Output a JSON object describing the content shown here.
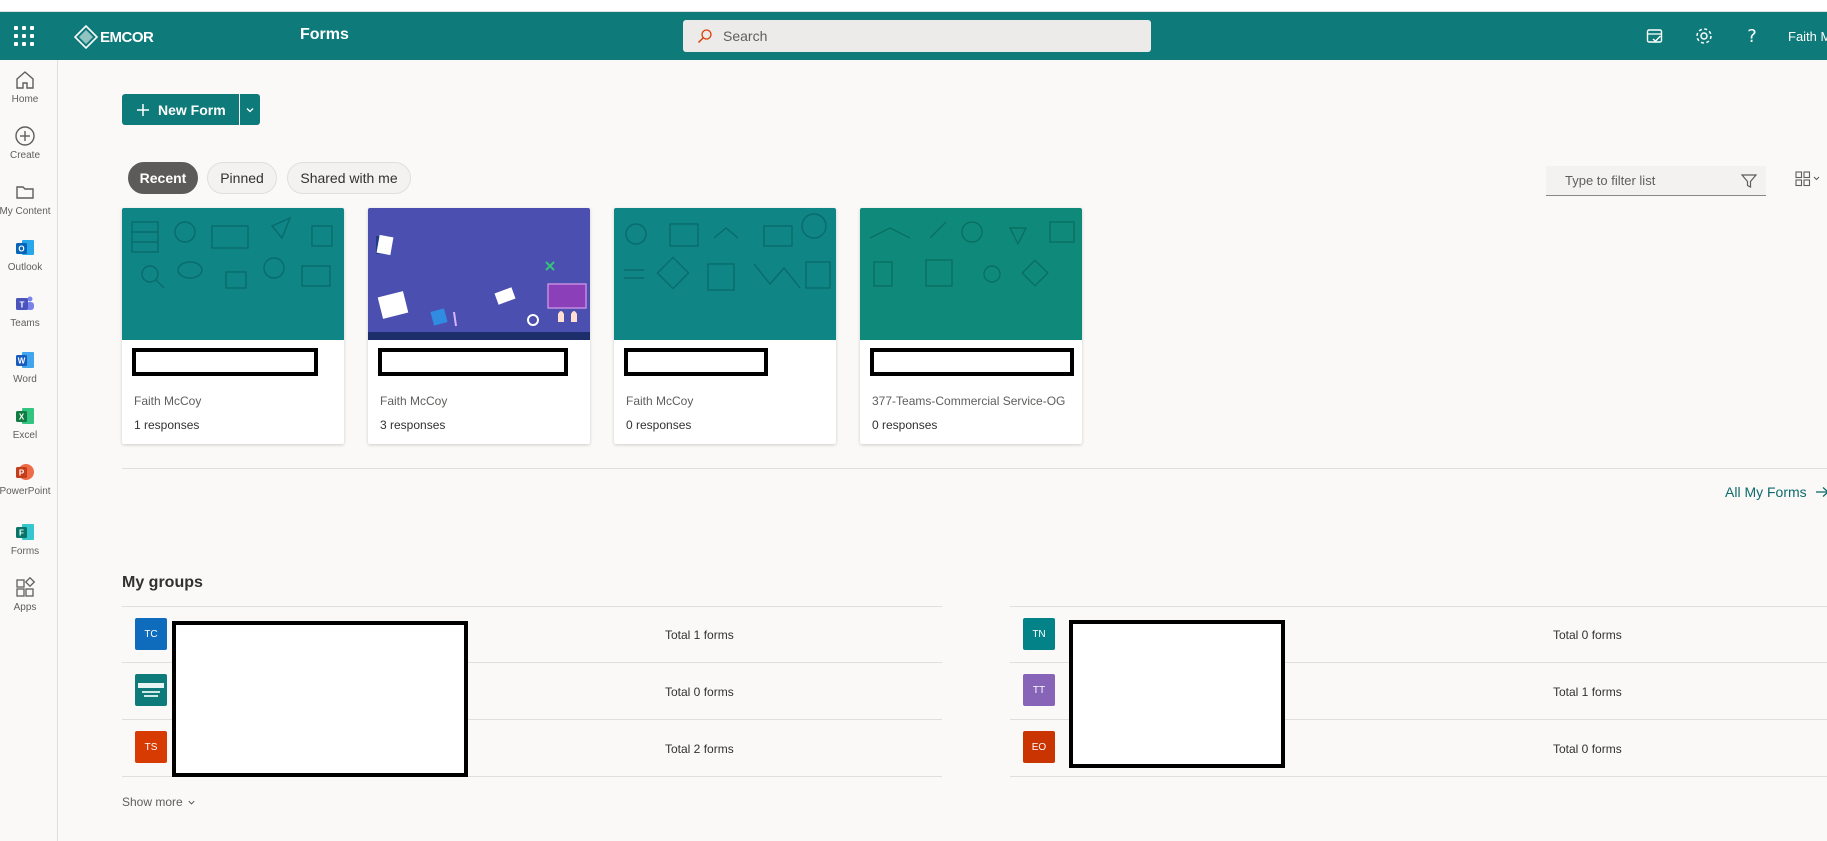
{
  "header": {
    "logo_text": "EMCOR",
    "app_name": "Forms",
    "search_placeholder": "Search",
    "user_name": "Faith M"
  },
  "rail": [
    {
      "label": "Home",
      "icon": "home-icon"
    },
    {
      "label": "Create",
      "icon": "plus-circle-icon"
    },
    {
      "label": "My Content",
      "icon": "folder-icon"
    },
    {
      "label": "Outlook",
      "icon": "outlook-icon"
    },
    {
      "label": "Teams",
      "icon": "teams-icon"
    },
    {
      "label": "Word",
      "icon": "word-icon"
    },
    {
      "label": "Excel",
      "icon": "excel-icon"
    },
    {
      "label": "PowerPoint",
      "icon": "powerpoint-icon"
    },
    {
      "label": "Forms",
      "icon": "forms-icon"
    },
    {
      "label": "Apps",
      "icon": "apps-icon"
    }
  ],
  "toolbar": {
    "new_form_label": "New Form"
  },
  "tabs": [
    {
      "label": "Recent",
      "active": true
    },
    {
      "label": "Pinned",
      "active": false
    },
    {
      "label": "Shared with me",
      "active": false
    }
  ],
  "filter": {
    "placeholder": "Type to filter list"
  },
  "cards": [
    {
      "owner": "Faith McCoy",
      "responses": "1 responses",
      "theme": "teal"
    },
    {
      "owner": "Faith McCoy",
      "responses": "3 responses",
      "theme": "purple"
    },
    {
      "owner": "Faith McCoy",
      "responses": "0 responses",
      "theme": "teal"
    },
    {
      "owner": "377-Teams-Commercial Service-OG",
      "responses": "0 responses",
      "theme": "green"
    }
  ],
  "all_my_forms_label": "All My Forms",
  "groups": {
    "title": "My groups",
    "left": [
      {
        "initials": "TC",
        "color": "#0f6cbd",
        "total": "Total 1 forms"
      },
      {
        "initials": "",
        "color": "#0f7a7a",
        "total": "Total 0 forms"
      },
      {
        "initials": "TS",
        "color": "#d83b01",
        "total": "Total 2 forms"
      }
    ],
    "right": [
      {
        "initials": "TN",
        "color": "#038387",
        "total": "Total 0 forms"
      },
      {
        "initials": "TT",
        "color": "#8764b8",
        "total": "Total 1 forms"
      },
      {
        "initials": "EO",
        "color": "#ca3400",
        "total": "Total 0 forms"
      }
    ],
    "show_more_label": "Show more"
  },
  "colors": {
    "brand": "#0f7a7a",
    "card_teal": "#0f8585",
    "card_purple": "#4a4fb0",
    "card_green": "#0f8a7a"
  }
}
